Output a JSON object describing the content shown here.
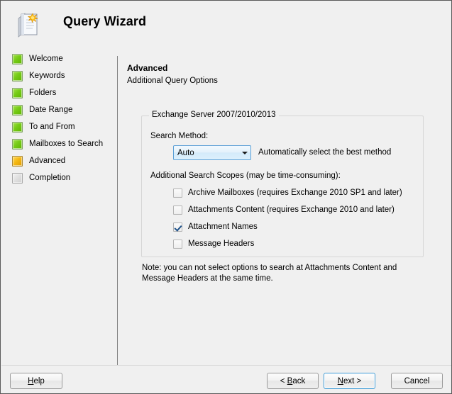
{
  "window": {
    "title": "Query Wizard",
    "icon": "wizard-notepad-sun-icon"
  },
  "sidebar": {
    "items": [
      {
        "label": "Welcome",
        "state": "done"
      },
      {
        "label": "Keywords",
        "state": "done"
      },
      {
        "label": "Folders",
        "state": "done"
      },
      {
        "label": "Date Range",
        "state": "done"
      },
      {
        "label": "To and From",
        "state": "done"
      },
      {
        "label": "Mailboxes to Search",
        "state": "done"
      },
      {
        "label": "Advanced",
        "state": "current"
      },
      {
        "label": "Completion",
        "state": "pending"
      }
    ]
  },
  "main": {
    "page_title": "Advanced",
    "page_subtitle": "Additional Query Options",
    "groupbox": {
      "caption": "Exchange Server 2007/2010/2013",
      "search_method_label": "Search Method:",
      "search_method_value": "Auto",
      "search_method_options": [
        "Auto"
      ],
      "search_method_hint": "Automatically select the best method",
      "scopes_label": "Additional Search Scopes (may be time-consuming):",
      "scopes": [
        {
          "label": "Archive Mailboxes (requires Exchange 2010 SP1 and later)",
          "checked": false
        },
        {
          "label": "Attachments Content (requires Exchange 2010 and later)",
          "checked": false
        },
        {
          "label": "Attachment Names",
          "checked": true
        },
        {
          "label": "Message Headers",
          "checked": false
        }
      ]
    },
    "note": "Note: you can not select options to search at Attachments Content and Message Headers at the same time."
  },
  "footer": {
    "help": {
      "pre": "",
      "accel": "H",
      "post": "elp"
    },
    "back": {
      "pre": "< ",
      "accel": "B",
      "post": "ack"
    },
    "next": {
      "pre": "",
      "accel": "N",
      "post": "ext >"
    },
    "cancel": {
      "pre": "Cancel",
      "accel": "",
      "post": ""
    }
  },
  "colors": {
    "background": "#f0f0f0",
    "step_done": "#76cc17",
    "step_current": "#f5b913",
    "step_pending": "#dcdcdc",
    "focus_blue": "#3c99d4",
    "combo_border": "#5b9fd6"
  }
}
